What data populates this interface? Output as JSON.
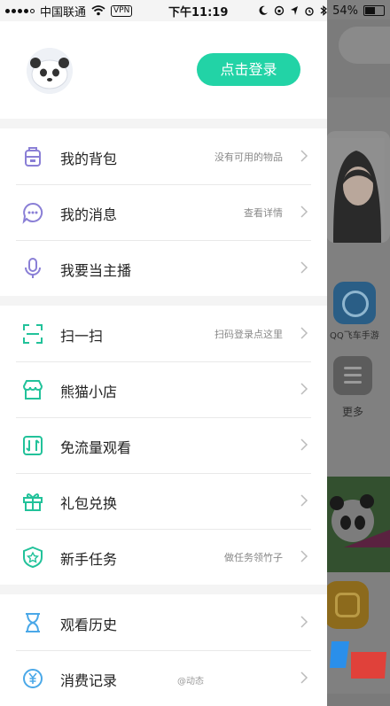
{
  "status_bar": {
    "carrier": "中国联通",
    "vpn": "VPN",
    "time": "下午11:19",
    "battery": "54%"
  },
  "profile": {
    "login_label": "点击登录"
  },
  "menu_group_1": [
    {
      "label": "我的背包",
      "hint": "没有可用的物品",
      "icon": "backpack-icon"
    },
    {
      "label": "我的消息",
      "hint": "查看详情",
      "icon": "message-icon"
    },
    {
      "label": "我要当主播",
      "hint": "",
      "icon": "microphone-icon"
    }
  ],
  "menu_group_2": [
    {
      "label": "扫一扫",
      "hint": "扫码登录点这里",
      "icon": "scan-icon"
    },
    {
      "label": "熊猫小店",
      "hint": "",
      "icon": "shop-icon"
    },
    {
      "label": "免流量观看",
      "hint": "",
      "icon": "free-data-icon"
    },
    {
      "label": "礼包兑换",
      "hint": "",
      "icon": "gift-icon"
    },
    {
      "label": "新手任务",
      "hint": "做任务领竹子",
      "icon": "task-icon"
    }
  ],
  "menu_group_3": [
    {
      "label": "观看历史",
      "hint": "",
      "icon": "hourglass-icon"
    },
    {
      "label": "消费记录",
      "hint": "",
      "icon": "yuan-icon"
    }
  ],
  "background": {
    "app_label": "QQ飞车手游",
    "more_label": "更多"
  },
  "watermark": {
    "text": "@动态"
  },
  "colors": {
    "accent": "#22d3a6",
    "purple_icon": "#8a7fd6",
    "green_icon": "#22c29a",
    "blue_icon": "#4aa8e8"
  }
}
